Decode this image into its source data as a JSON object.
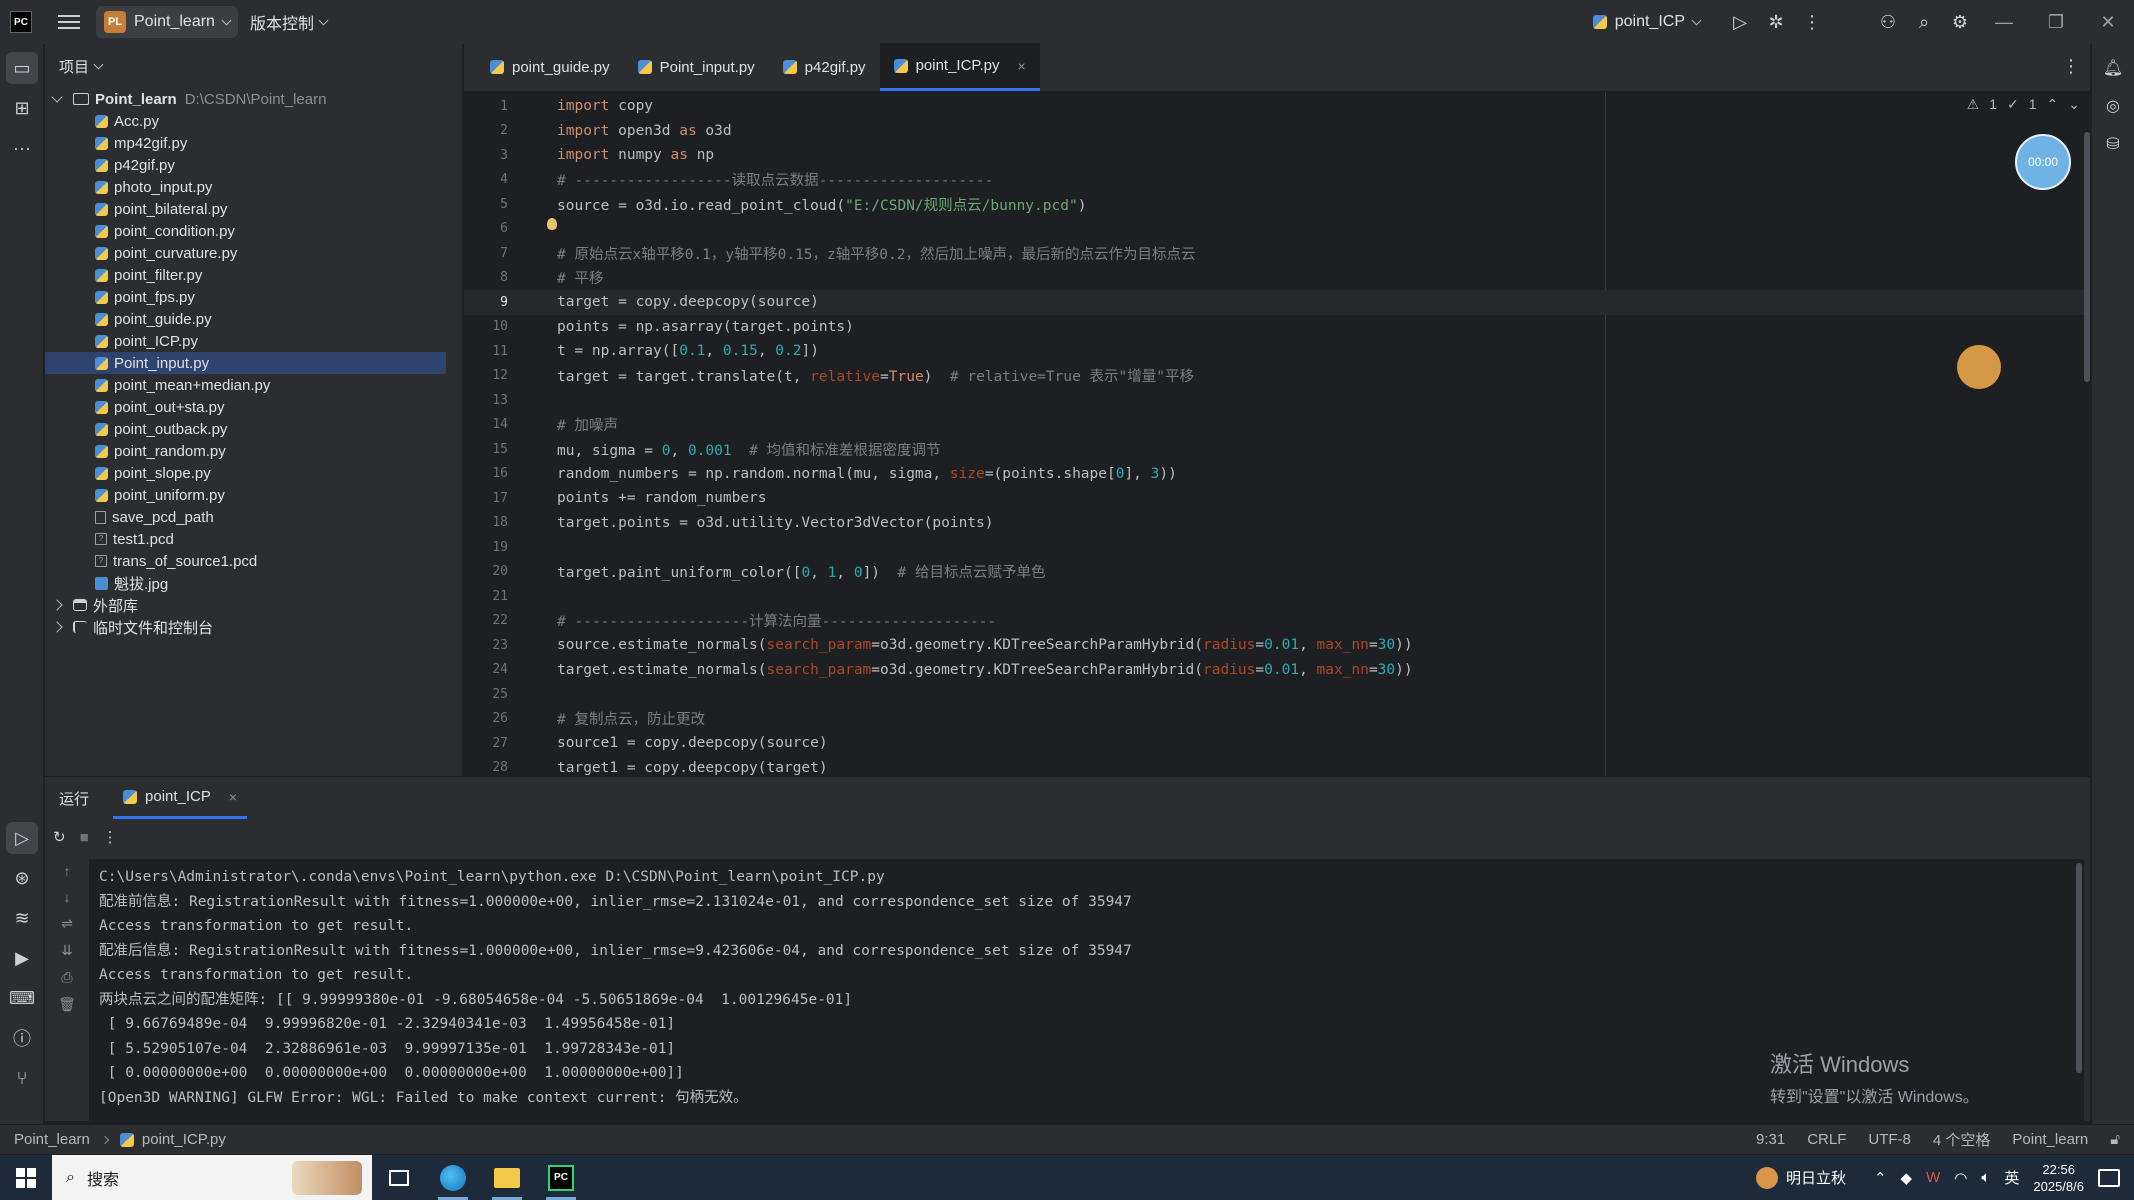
{
  "titlebar": {
    "app_icon": "PC",
    "project_badge": "PL",
    "project_name": "Point_learn",
    "vcs_label": "版本控制",
    "run_config": "point_ICP",
    "icons": [
      "hamburger-menu-icon",
      "run-icon",
      "debug-icon",
      "more-icon",
      "add-user-icon",
      "search-icon",
      "settings-icon",
      "minimize-icon",
      "restore-icon",
      "close-icon"
    ]
  },
  "project_panel": {
    "header": "项目",
    "root_name": "Point_learn",
    "root_path": "D:\\CSDN\\Point_learn",
    "files": [
      {
        "name": "Acc.py",
        "type": "py"
      },
      {
        "name": "mp42gif.py",
        "type": "py"
      },
      {
        "name": "p42gif.py",
        "type": "py"
      },
      {
        "name": "photo_input.py",
        "type": "py"
      },
      {
        "name": "point_bilateral.py",
        "type": "py"
      },
      {
        "name": "point_condition.py",
        "type": "py"
      },
      {
        "name": "point_curvature.py",
        "type": "py"
      },
      {
        "name": "point_filter.py",
        "type": "py"
      },
      {
        "name": "point_fps.py",
        "type": "py"
      },
      {
        "name": "point_guide.py",
        "type": "py"
      },
      {
        "name": "point_ICP.py",
        "type": "py"
      },
      {
        "name": "Point_input.py",
        "type": "py",
        "selected": true
      },
      {
        "name": "point_mean+median.py",
        "type": "py"
      },
      {
        "name": "point_out+sta.py",
        "type": "py"
      },
      {
        "name": "point_outback.py",
        "type": "py"
      },
      {
        "name": "point_random.py",
        "type": "py"
      },
      {
        "name": "point_slope.py",
        "type": "py"
      },
      {
        "name": "point_uniform.py",
        "type": "py"
      },
      {
        "name": "save_pcd_path",
        "type": "txt"
      },
      {
        "name": "test1.pcd",
        "type": "pcd"
      },
      {
        "name": "trans_of_source1.pcd",
        "type": "pcd"
      },
      {
        "name": "魁拔.jpg",
        "type": "img"
      }
    ],
    "external_libs": "外部库",
    "scratches": "临时文件和控制台"
  },
  "editor": {
    "tabs": [
      {
        "label": "point_guide.py",
        "active": false
      },
      {
        "label": "Point_input.py",
        "active": false
      },
      {
        "label": "p42gif.py",
        "active": false
      },
      {
        "label": "point_ICP.py",
        "active": true
      }
    ],
    "inspection": {
      "warnings": "1",
      "checks": "1"
    },
    "timer": "00:00",
    "current_line": 9,
    "lines": [
      "import copy",
      "import open3d as o3d",
      "import numpy as np",
      "# ------------------读取点云数据--------------------",
      "source = o3d.io.read_point_cloud(\"E:/CSDN/规则点云/bunny.pcd\")",
      "",
      "# 原始点云x轴平移0.1，y轴平移0.15，z轴平移0.2，然后加上噪声，最后新的点云作为目标点云",
      "# 平移",
      "target = copy.deepcopy(source)",
      "points = np.asarray(target.points)",
      "t = np.array([0.1, 0.15, 0.2])",
      "target = target.translate(t, relative=True)  # relative=True 表示\"增量\"平移",
      "",
      "# 加噪声",
      "mu, sigma = 0, 0.001  # 均值和标准差根据密度调节",
      "random_numbers = np.random.normal(mu, sigma, size=(points.shape[0], 3))",
      "points += random_numbers",
      "target.points = o3d.utility.Vector3dVector(points)",
      "",
      "target.paint_uniform_color([0, 1, 0])  # 给目标点云赋予单色",
      "",
      "# --------------------计算法向量--------------------",
      "source.estimate_normals(search_param=o3d.geometry.KDTreeSearchParamHybrid(radius=0.01, max_nn=30))",
      "target.estimate_normals(search_param=o3d.geometry.KDTreeSearchParamHybrid(radius=0.01, max_nn=30))",
      "",
      "# 复制点云，防止更改",
      "source1 = copy.deepcopy(source)",
      "target1 = copy.deepcopy(target)"
    ]
  },
  "run_panel": {
    "title": "运行",
    "tab_label": "point_ICP",
    "console": [
      "C:\\Users\\Administrator\\.conda\\envs\\Point_learn\\python.exe D:\\CSDN\\Point_learn\\point_ICP.py",
      "配准前信息: RegistrationResult with fitness=1.000000e+00, inlier_rmse=2.131024e-01, and correspondence_set size of 35947",
      "Access transformation to get result.",
      "配准后信息: RegistrationResult with fitness=1.000000e+00, inlier_rmse=9.423606e-04, and correspondence_set size of 35947",
      "Access transformation to get result.",
      "两块点云之间的配准矩阵: [[ 9.99999380e-01 -9.68054658e-04 -5.50651869e-04  1.00129645e-01]",
      " [ 9.66769489e-04  9.99996820e-01 -2.32940341e-03  1.49956458e-01]",
      " [ 5.52905107e-04  2.32886961e-03  9.99997135e-01  1.99728343e-01]",
      " [ 0.00000000e+00  0.00000000e+00  0.00000000e+00  1.00000000e+00]]",
      "[Open3D WARNING] GLFW Error: WGL: Failed to make context current: 句柄无效。"
    ],
    "watermark_title": "激活 Windows",
    "watermark_sub": "转到\"设置\"以激活 Windows。"
  },
  "statusbar": {
    "crumb_project": "Point_learn",
    "crumb_file": "point_ICP.py",
    "position": "9:31",
    "line_sep": "CRLF",
    "encoding": "UTF-8",
    "indent": "4 个空格",
    "interpreter": "Point_learn"
  },
  "taskbar": {
    "search_placeholder": "搜索",
    "weather": "明日立秋",
    "ime": "英",
    "time": "22:56",
    "date": "2025/8/6"
  }
}
